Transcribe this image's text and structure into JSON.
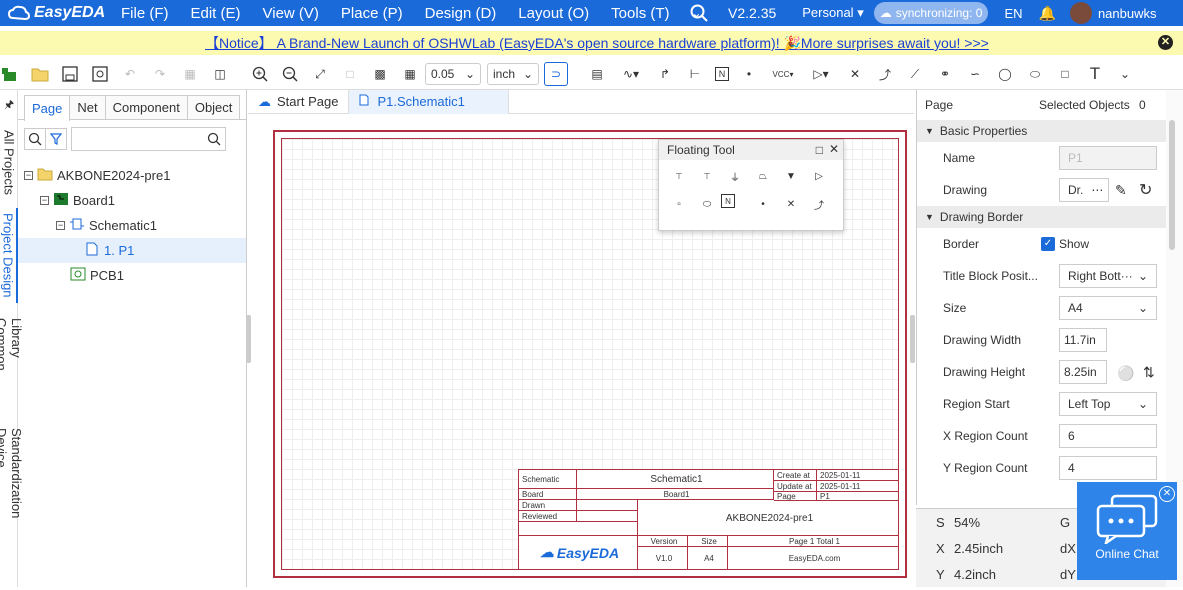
{
  "app": {
    "name": "EasyEDA",
    "version": "V2.2.35",
    "account_type": "Personal",
    "sync_status": "synchronizing: 0",
    "language": "EN",
    "username": "nanbuwks"
  },
  "menu": [
    "File (F)",
    "Edit (E)",
    "View (V)",
    "Place (P)",
    "Design (D)",
    "Layout (O)",
    "Tools (T)"
  ],
  "notice": {
    "text": "【Notice】 A Brand-New Launch of OSHWLab (EasyEDA's open source hardware platform)! 🎉More surprises await you! >>>"
  },
  "toolbar": {
    "grid_value": "0.05",
    "unit": "inch"
  },
  "left_strip_tabs": [
    "All Projects",
    "Project Design",
    "Common Library",
    "Device Standardization"
  ],
  "panel_tabs": [
    "Page",
    "Net",
    "Component",
    "Object"
  ],
  "tree": [
    {
      "label": "AKBONE2024-pre1",
      "level": 0,
      "icon": "folder-icon"
    },
    {
      "label": "Board1",
      "level": 1,
      "icon": "board-icon"
    },
    {
      "label": "Schematic1",
      "level": 2,
      "icon": "schematic-icon"
    },
    {
      "label": "1. P1",
      "level": 3,
      "icon": "page-icon",
      "selected": true
    },
    {
      "label": "PCB1",
      "level": 2,
      "icon": "pcb-icon"
    }
  ],
  "doc_tabs": [
    "Start Page",
    "P1.Schematic1"
  ],
  "floating_tool": {
    "title": "Floating Tool",
    "items": [
      "VCC",
      "+5V",
      "GND",
      "PGND",
      "GND2",
      "NetPort",
      "NetLabel",
      "Bus",
      "NoConnect",
      "Junction",
      "NoConnectFlag",
      "Wire"
    ]
  },
  "title_block": {
    "schematic_label": "Schematic",
    "schematic_value": "Schematic1",
    "create_label": "Create at",
    "create_value": "2025-01-11",
    "update_label": "Update at",
    "update_value": "2025-01-11",
    "board_label": "Board",
    "board_value": "Board1",
    "page_label": "Page",
    "page_value": "P1",
    "drawn_label": "Drawn",
    "reviewed_label": "Reviewed",
    "project_value": "AKBONE2024-pre1",
    "version_label": "Version",
    "version_value": "V1.0",
    "size_label": "Size",
    "size_value": "A4",
    "page_total": "Page  1  Total  1",
    "site": "EasyEDA.com",
    "logo": "EasyEDA"
  },
  "right_panel": {
    "header_left": "Page",
    "header_right": "Selected Objects",
    "selected_count": "0",
    "basic_section": "Basic Properties",
    "name_label": "Name",
    "name_value": "P1",
    "drawing_label": "Drawing",
    "drawing_value": "Dr.",
    "border_section": "Drawing Border",
    "border_label": "Border",
    "border_show": "Show",
    "title_block_label": "Title Block Posit...",
    "title_block_value": "Right Bott···",
    "size_label": "Size",
    "size_value": "A4",
    "width_label": "Drawing Width",
    "width_value": "11.7in",
    "height_label": "Drawing Height",
    "height_value": "8.25in",
    "region_start_label": "Region Start",
    "region_start_value": "Left Top",
    "x_region_label": "X Region Count",
    "x_region_value": "6",
    "y_region_label": "Y Region Count",
    "y_region_value": "4"
  },
  "status": {
    "s_label": "S",
    "s_value": "54%",
    "g_label": "G",
    "x_label": "X",
    "x_value": "2.45inch",
    "dx_label": "dX",
    "y_label": "Y",
    "y_value": "4.2inch",
    "dy_label": "dY"
  },
  "chat": {
    "label": "Online Chat"
  },
  "colors": {
    "brand": "#1b6ad9",
    "notice_bg": "#fcfab0",
    "sheet_border": "#b03040",
    "chat_bg": "#2e84e8"
  }
}
